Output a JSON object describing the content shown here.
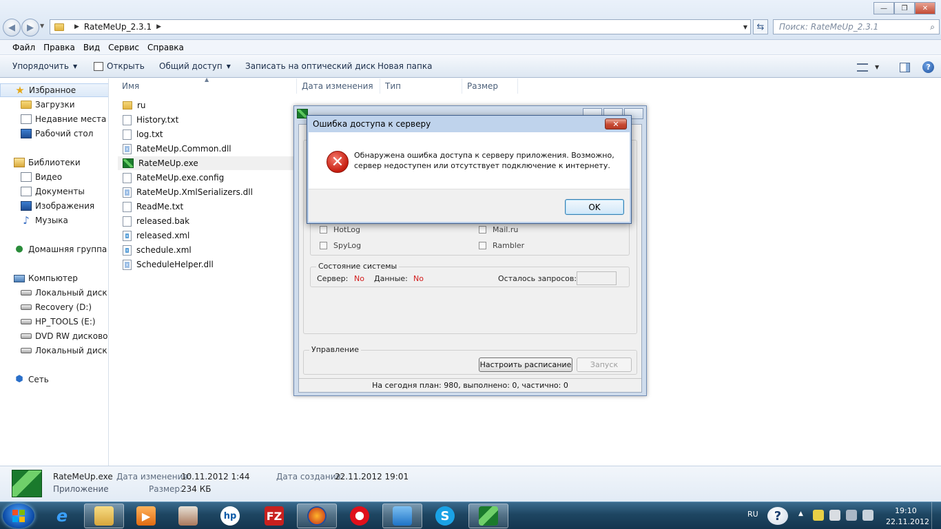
{
  "explorer": {
    "breadcrumb": [
      "RateMeUp_2.3.1"
    ],
    "search_placeholder": "Поиск: RateMeUp_2.3.1",
    "menu": [
      "Файл",
      "Правка",
      "Вид",
      "Сервис",
      "Справка"
    ],
    "toolbar": {
      "organize": "Упорядочить",
      "open": "Открыть",
      "share": "Общий доступ",
      "burn": "Записать на оптический диск",
      "new_folder": "Новая папка"
    },
    "nav": {
      "favorites": "Избранное",
      "downloads": "Загрузки",
      "recent": "Недавние места",
      "desktop": "Рабочий стол",
      "libraries": "Библиотеки",
      "video": "Видео",
      "documents": "Документы",
      "pictures": "Изображения",
      "music": "Музыка",
      "homegroup": "Домашняя группа",
      "computer": "Компьютер",
      "drive_c": "Локальный диск (C",
      "drive_d": "Recovery (D:)",
      "drive_e": "HP_TOOLS (E:)",
      "drive_dvd": "DVD RW дисковод (",
      "drive_q": "Локальный диск (Q",
      "network": "Сеть"
    },
    "columns": {
      "name": "Имя",
      "date": "Дата изменения",
      "type": "Тип",
      "size": "Размер"
    },
    "files": [
      {
        "name": "ru",
        "icon": "folder-icon"
      },
      {
        "name": "History.txt",
        "icon": "text-file-icon"
      },
      {
        "name": "log.txt",
        "icon": "text-file-icon"
      },
      {
        "name": "RateMeUp.Common.dll",
        "icon": "dll-file-icon"
      },
      {
        "name": "RateMeUp.exe",
        "icon": "ratemeup-app-icon"
      },
      {
        "name": "RateMeUp.exe.config",
        "icon": "text-file-icon"
      },
      {
        "name": "RateMeUp.XmlSerializers.dll",
        "icon": "dll-file-icon"
      },
      {
        "name": "ReadMe.txt",
        "icon": "text-file-icon"
      },
      {
        "name": "released.bak",
        "icon": "text-file-icon"
      },
      {
        "name": "released.xml",
        "icon": "xml-file-icon"
      },
      {
        "name": "schedule.xml",
        "icon": "xml-file-icon"
      },
      {
        "name": "ScheduleHelper.dll",
        "icon": "dll-file-icon"
      }
    ]
  },
  "app_window": {
    "checkboxes": {
      "hotlog": "HotLog",
      "mailru": "Mail.ru",
      "spylog": "SpyLog",
      "rambler": "Rambler"
    },
    "system_state": {
      "legend": "Состояние системы",
      "server_label": "Сервер:",
      "server_value": "No",
      "data_label": "Данные:",
      "data_value": "No",
      "requests_left_label": "Осталось запросов:"
    },
    "control": {
      "legend": "Управление",
      "schedule_button": "Настроить расписание",
      "start_button": "Запуск"
    },
    "status": "На сегодня план: 980, выполнено: 0, частично: 0"
  },
  "dialog": {
    "title": "Ошибка доступа к серверу",
    "message": "Обнаружена ошибка доступа к серверу приложения. Возможно, сервер недоступен или отсутствует подключение к интернету.",
    "ok": "OK",
    "close": "✕"
  },
  "details": {
    "name": "RateMeUp.exe",
    "kind": "Приложение",
    "modified_label": "Дата изменения:",
    "modified_value": "10.11.2012 1:44",
    "created_label": "Дата создания:",
    "created_value": "22.11.2012 19:01",
    "size_label": "Размер:",
    "size_value": "234 КБ"
  },
  "taskbar": {
    "lang": "RU",
    "time": "19:10",
    "date": "22.11.2012",
    "apps": [
      "internet-explorer-icon",
      "explorer-icon",
      "media-player-icon",
      "scanner-icon",
      "hp-icon",
      "filezilla-icon",
      "firefox-icon",
      "opera-icon",
      "virtualbox-icon",
      "skype-icon",
      "ratemeup-icon"
    ]
  },
  "colors": {
    "error_red": "#d21b1b",
    "dialog_frame": "#bfd3ec",
    "taskbar": "#1e4662"
  }
}
